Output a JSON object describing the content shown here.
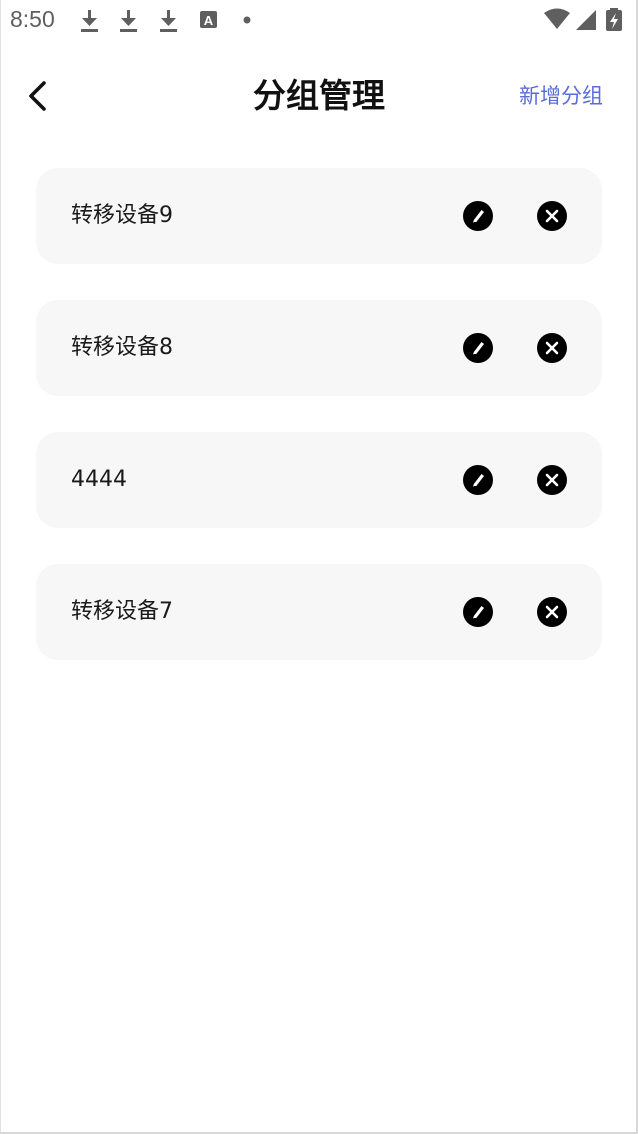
{
  "status_bar": {
    "time": "8:50",
    "left_icons": [
      "download-icon",
      "download-icon",
      "download-icon",
      "font-icon",
      "dot-icon"
    ],
    "right_icons": [
      "wifi-icon",
      "signal-icon",
      "battery-icon"
    ]
  },
  "header": {
    "title": "分组管理",
    "add_label": "新增分组"
  },
  "groups": [
    {
      "name": "转移设备9"
    },
    {
      "name": "转移设备8"
    },
    {
      "name": "4444"
    },
    {
      "name": "转移设备7"
    }
  ],
  "colors": {
    "accent": "#5b6cd9",
    "card_bg": "#f7f7f7",
    "title": "#111111"
  }
}
